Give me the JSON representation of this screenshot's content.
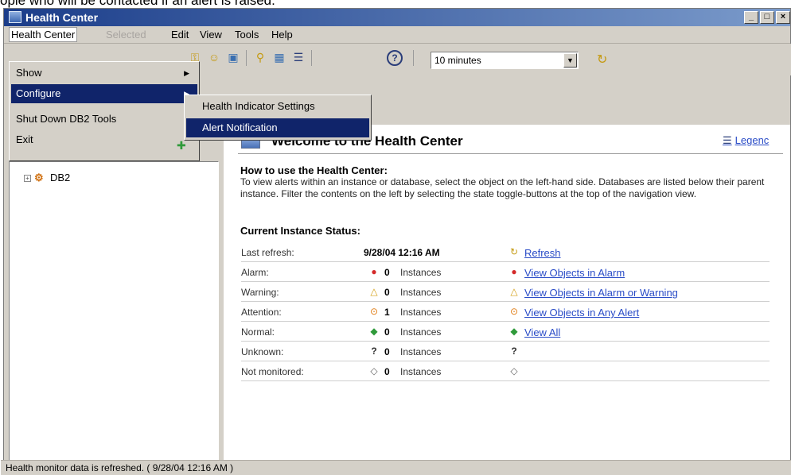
{
  "caption": "ople who will be contacted if an alert is raised.",
  "window": {
    "title": "Health Center",
    "controls": [
      "_",
      "□",
      "×"
    ]
  },
  "menubar": [
    {
      "label": "Health Center",
      "state": "active"
    },
    {
      "label": "Selected",
      "state": "disabled"
    },
    {
      "label": "Edit",
      "state": "normal"
    },
    {
      "label": "View",
      "state": "normal"
    },
    {
      "label": "Tools",
      "state": "normal"
    },
    {
      "label": "Help",
      "state": "normal"
    }
  ],
  "dropdown": {
    "items": [
      {
        "label": "Show",
        "submenu": true
      },
      {
        "label": "Configure",
        "submenu": true,
        "highlighted": true
      },
      {
        "label": "Shut Down DB2 Tools",
        "submenu": false
      },
      {
        "label": "Exit",
        "submenu": false
      }
    ],
    "exit_icon": "exit-icon"
  },
  "submenu": {
    "items": [
      {
        "label": "Health Indicator Settings",
        "highlighted": false
      },
      {
        "label": "Alert Notification",
        "highlighted": true
      }
    ]
  },
  "toolbar": {
    "icons": [
      "key-icon",
      "user-icon",
      "monitor-icon",
      "alarm-filter-icon",
      "grid-icon",
      "list-icon"
    ],
    "help_icon": "help-icon",
    "interval": "10 minutes",
    "refresh_icon": "refresh-icon"
  },
  "tree": {
    "root_label": "DB2",
    "expander": "+"
  },
  "welcome": {
    "title": "Welcome to the Health Center",
    "legend": "Legenc",
    "howto_title": "How to use the Health Center:",
    "howto_body": "To view alerts within an instance or database, select the object on the left-hand side. Databases are listed below their parent instance. Filter the contents on the left by selecting the state toggle-buttons at the top of the navigation view.",
    "status_title": "Current Instance Status:"
  },
  "status": {
    "last_refresh_label": "Last refresh:",
    "last_refresh_value": "9/28/04 12:16 AM",
    "refresh_link": "Refresh",
    "rows": [
      {
        "label": "Alarm:",
        "mark": "●",
        "mark_class": "c-alarm",
        "count": "0",
        "unit": "Instances",
        "link_mark": "●",
        "link": "View Objects in Alarm"
      },
      {
        "label": "Warning:",
        "mark": "△",
        "mark_class": "c-warning",
        "count": "0",
        "unit": "Instances",
        "link_mark": "△",
        "link": "View Objects in Alarm or Warning"
      },
      {
        "label": "Attention:",
        "mark": "⊙",
        "mark_class": "c-attention",
        "count": "1",
        "unit": "Instances",
        "link_mark": "⊙",
        "link": "View Objects in Any Alert"
      },
      {
        "label": "Normal:",
        "mark": "◆",
        "mark_class": "c-normal",
        "count": "0",
        "unit": "Instances",
        "link_mark": "◆",
        "link": "View All"
      },
      {
        "label": "Unknown:",
        "mark": "?",
        "mark_class": "c-unknown",
        "count": "0",
        "unit": "Instances",
        "link_mark": "?",
        "link": ""
      },
      {
        "label": "Not monitored:",
        "mark": "◇",
        "mark_class": "c-unmon",
        "count": "0",
        "unit": "Instances",
        "link_mark": "◇",
        "link": ""
      }
    ]
  },
  "statusbar": "Health monitor data is refreshed.  ( 9/28/04 12:16 AM )"
}
